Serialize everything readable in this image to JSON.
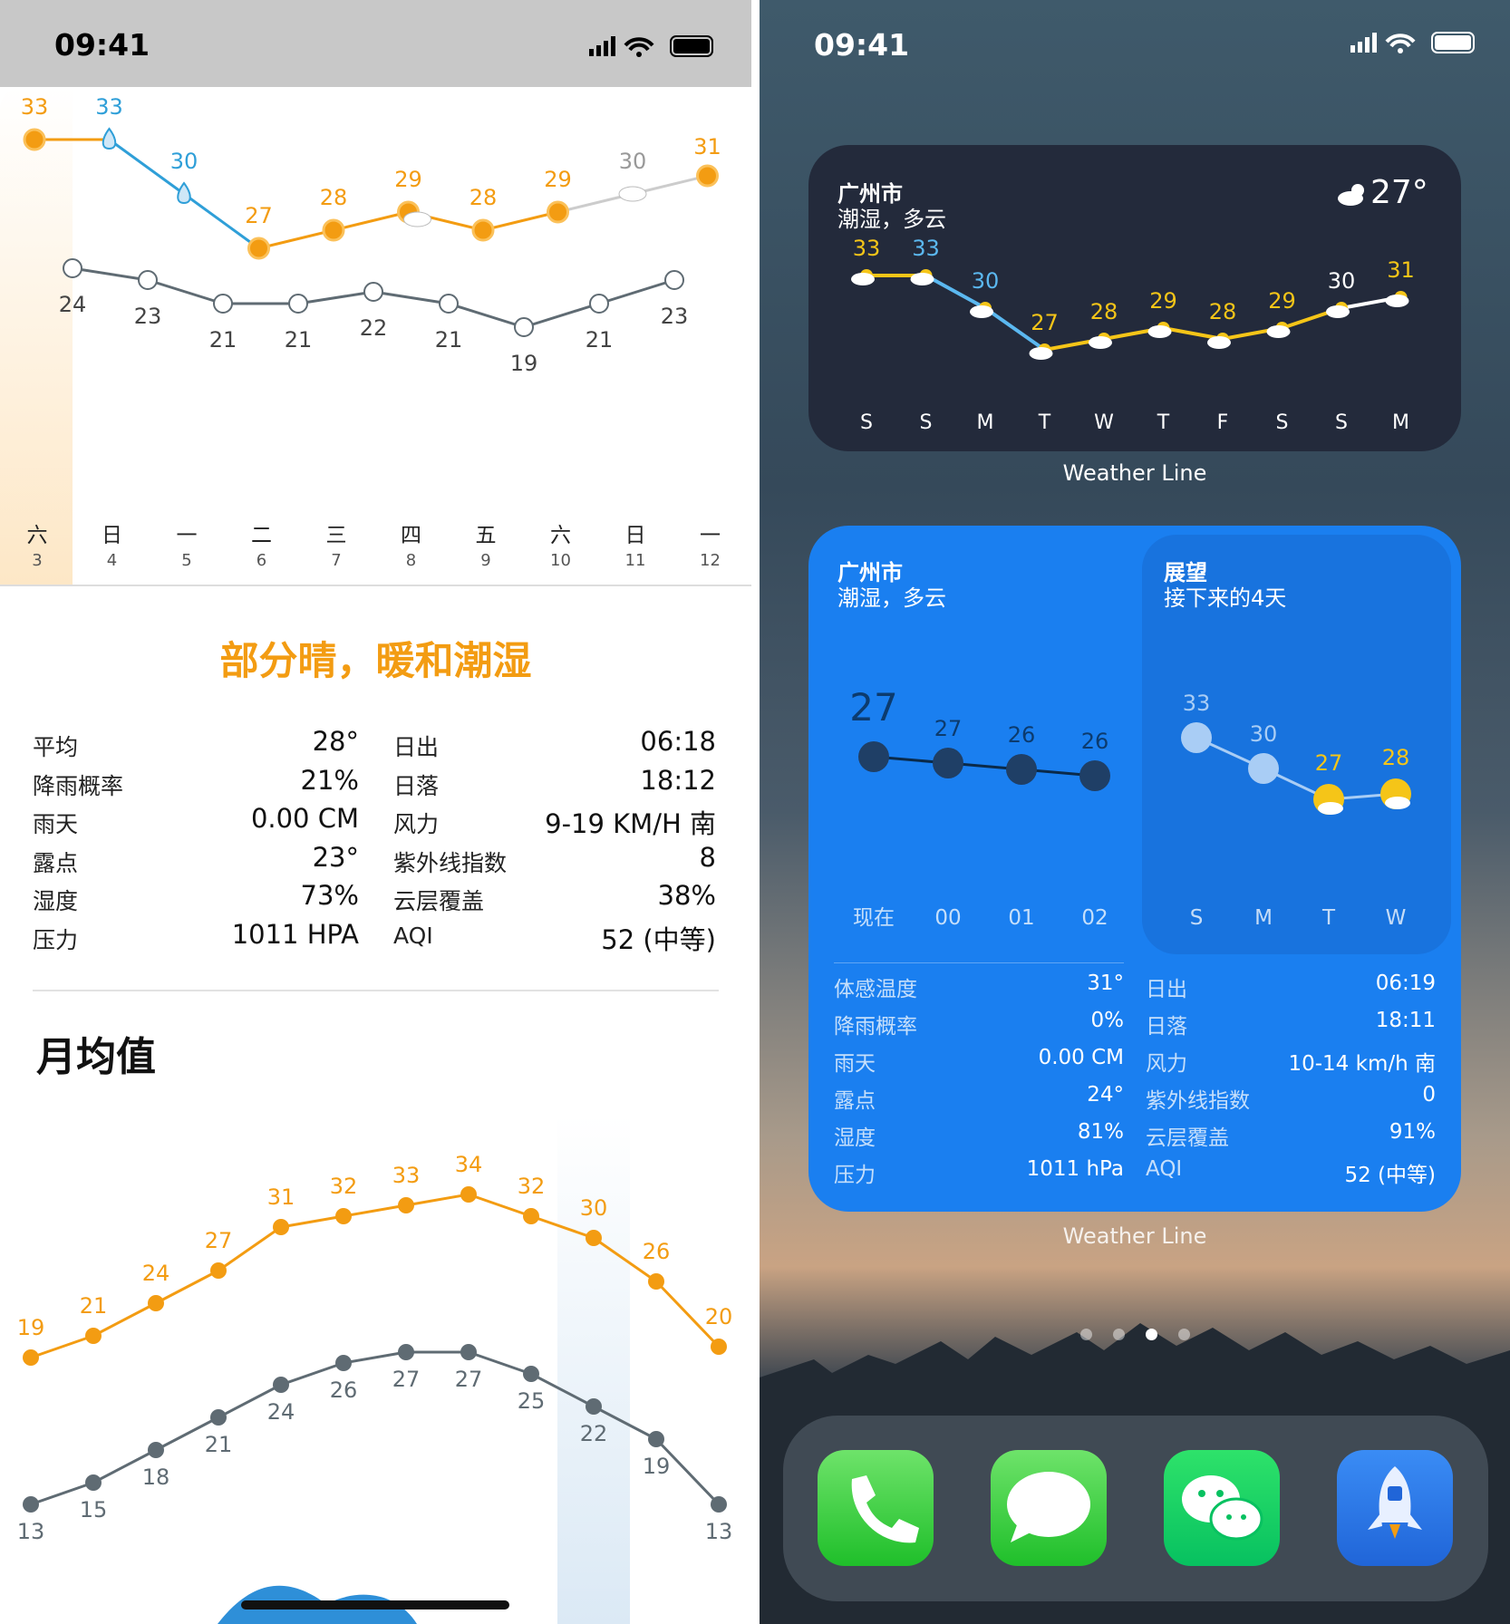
{
  "status": {
    "time_left": "09:41",
    "time_right": "09:41"
  },
  "left": {
    "hourly_high_labels": [
      "33",
      "33",
      "30",
      "27",
      "28",
      "29",
      "28",
      "29",
      "30",
      "31"
    ],
    "hourly_low_labels": [
      "24",
      "23",
      "21",
      "21",
      "22",
      "21",
      "19",
      "21",
      "23"
    ],
    "days": [
      {
        "w": "六",
        "d": "3"
      },
      {
        "w": "日",
        "d": "4"
      },
      {
        "w": "一",
        "d": "5"
      },
      {
        "w": "二",
        "d": "6"
      },
      {
        "w": "三",
        "d": "7"
      },
      {
        "w": "四",
        "d": "8"
      },
      {
        "w": "五",
        "d": "9"
      },
      {
        "w": "六",
        "d": "10"
      },
      {
        "w": "日",
        "d": "11"
      },
      {
        "w": "一",
        "d": "12"
      }
    ],
    "summary": "部分晴，暖和潮湿",
    "stats_left": [
      {
        "label": "平均",
        "value": "28°"
      },
      {
        "label": "降雨概率",
        "value": "21%"
      },
      {
        "label": "雨天",
        "value": "0.00 CM"
      },
      {
        "label": "露点",
        "value": "23°"
      },
      {
        "label": "湿度",
        "value": "73%"
      },
      {
        "label": "压力",
        "value": "1011 HPA"
      }
    ],
    "stats_right": [
      {
        "label": "日出",
        "value": "06:18"
      },
      {
        "label": "日落",
        "value": "18:12"
      },
      {
        "label": "风力",
        "value": "9-19 KM/H 南"
      },
      {
        "label": "紫外线指数",
        "value": "8"
      },
      {
        "label": "云层覆盖",
        "value": "38%"
      },
      {
        "label": "AQI",
        "value": "52 (中等)"
      }
    ],
    "monthly_title": "月均值",
    "monthly_high": [
      "19",
      "21",
      "24",
      "27",
      "31",
      "32",
      "33",
      "34",
      "32",
      "30",
      "26",
      "20"
    ],
    "monthly_low": [
      "13",
      "15",
      "18",
      "21",
      "24",
      "26",
      "27",
      "27",
      "25",
      "22",
      "19",
      "13"
    ]
  },
  "chart_data": [
    {
      "type": "line",
      "series": [
        {
          "values": [
            33,
            33,
            30,
            27,
            28,
            29,
            28,
            29,
            30,
            31
          ]
        },
        {
          "values": [
            24,
            23,
            21,
            21,
            22,
            21,
            19,
            21,
            23
          ]
        }
      ]
    },
    {
      "type": "line",
      "series": [
        {
          "values": [
            19,
            21,
            24,
            27,
            31,
            32,
            33,
            34,
            32,
            30,
            26,
            20
          ]
        },
        {
          "values": [
            13,
            15,
            18,
            21,
            24,
            26,
            27,
            27,
            25,
            22,
            19,
            13
          ]
        }
      ]
    },
    {
      "type": "line",
      "categories": [
        "S",
        "S",
        "M",
        "T",
        "W",
        "T",
        "F",
        "S",
        "S",
        "M"
      ],
      "series": [
        {
          "values": [
            33,
            33,
            30,
            27,
            28,
            29,
            28,
            29,
            30,
            31
          ]
        }
      ]
    },
    {
      "type": "line",
      "categories": [
        "现在",
        "00",
        "01",
        "02"
      ],
      "series": [
        {
          "values": [
            27,
            27,
            26,
            26
          ]
        }
      ]
    },
    {
      "type": "line",
      "categories": [
        "S",
        "M",
        "T",
        "W"
      ],
      "series": [
        {
          "values": [
            33,
            30,
            27,
            28
          ]
        }
      ]
    }
  ],
  "widget1": {
    "city": "广州市",
    "cond": "潮湿，多云",
    "temp": "27°",
    "labels": [
      "33",
      "33",
      "30",
      "27",
      "28",
      "29",
      "28",
      "29",
      "30",
      "31"
    ],
    "days": [
      "S",
      "S",
      "M",
      "T",
      "W",
      "T",
      "F",
      "S",
      "S",
      "M"
    ],
    "caption": "Weather Line"
  },
  "widget2": {
    "city": "广州市",
    "cond": "潮湿，多云",
    "hour_labels": [
      "27",
      "27",
      "26",
      "26"
    ],
    "hours": [
      "现在",
      "00",
      "01",
      "02"
    ],
    "outlook_title": "展望",
    "outlook_sub": "接下来的4天",
    "outlook_labels": [
      "33",
      "30",
      "27",
      "28"
    ],
    "outlook_days": [
      "S",
      "M",
      "T",
      "W"
    ],
    "stats_left": [
      {
        "label": "体感温度",
        "value": "31°"
      },
      {
        "label": "降雨概率",
        "value": "0%"
      },
      {
        "label": "雨天",
        "value": "0.00 CM"
      },
      {
        "label": "露点",
        "value": "24°"
      },
      {
        "label": "湿度",
        "value": "81%"
      },
      {
        "label": "压力",
        "value": "1011 hPa"
      }
    ],
    "stats_right": [
      {
        "label": "日出",
        "value": "06:19"
      },
      {
        "label": "日落",
        "value": "18:11"
      },
      {
        "label": "风力",
        "value": "10-14 km/h 南"
      },
      {
        "label": "紫外线指数",
        "value": "0"
      },
      {
        "label": "云层覆盖",
        "value": "91%"
      },
      {
        "label": "AQI",
        "value": "52 (中等)"
      }
    ],
    "caption": "Weather Line"
  },
  "dock": [
    "phone-app",
    "messages-app",
    "wechat-app",
    "rocket-app"
  ],
  "colors": {
    "orange": "#f39c12",
    "blue": "#2f9fd8",
    "gray": "#5f6b73",
    "widget_dark": "#232a3b",
    "widget_blue": "#1a7ff0"
  }
}
